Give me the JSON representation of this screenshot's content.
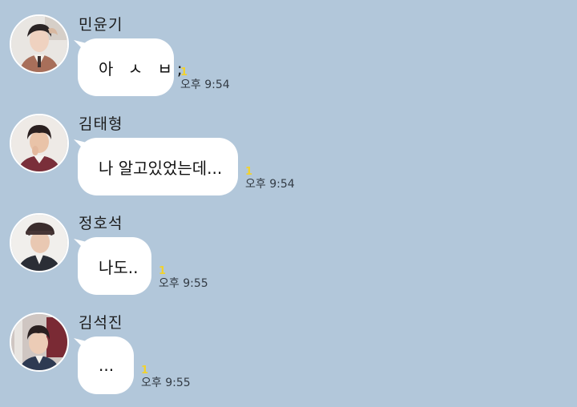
{
  "chat": {
    "background": "#b2c7da",
    "messages": [
      {
        "sender": "민윤기",
        "text": "아 ㅅ ㅂ;",
        "unread": "1",
        "time": "오후 9:54",
        "avatar": "person-photo-icon"
      },
      {
        "sender": "김태형",
        "text": "나 알고있었는데...",
        "unread": "1",
        "time": "오후 9:54",
        "avatar": "person-photo-icon"
      },
      {
        "sender": "정호석",
        "text": "나도..",
        "unread": "1",
        "time": "오후 9:55",
        "avatar": "person-photo-icon"
      },
      {
        "sender": "김석진",
        "text": "...",
        "unread": "1",
        "time": "오후 9:55",
        "avatar": "person-photo-icon"
      }
    ]
  }
}
